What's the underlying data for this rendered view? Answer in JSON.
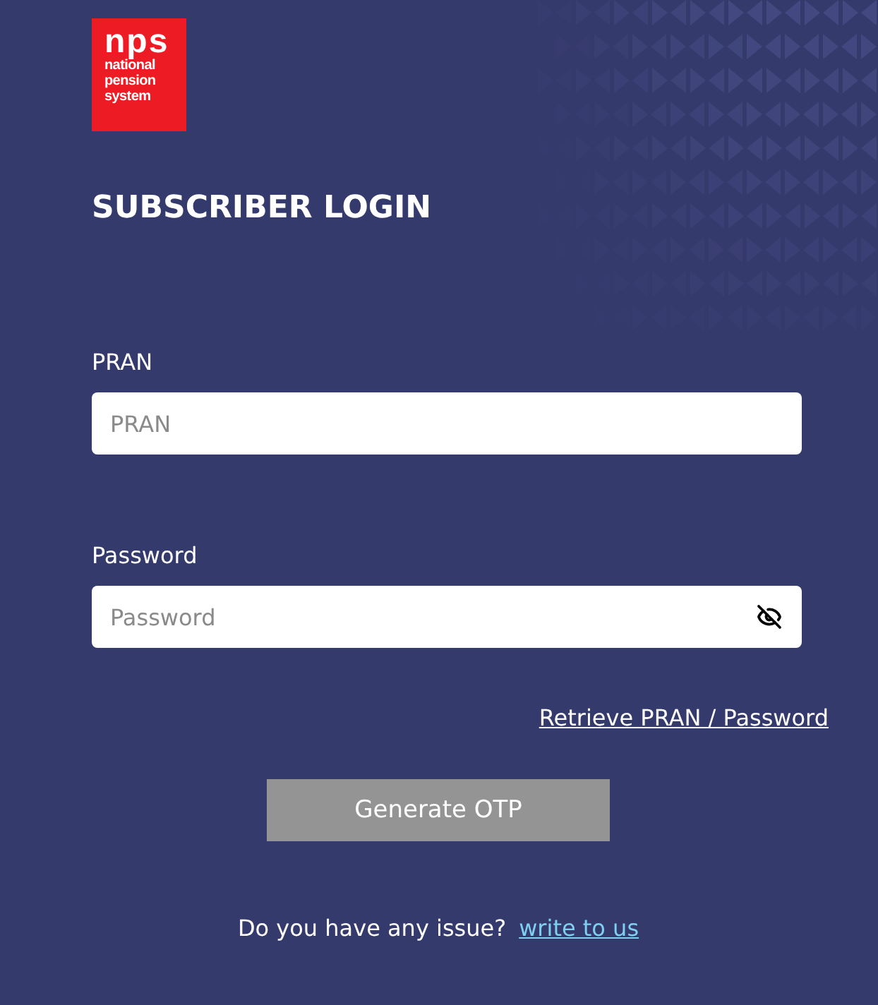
{
  "logo": {
    "mark": "nps",
    "lines": [
      "national",
      "pension",
      "system"
    ]
  },
  "title": "SUBSCRIBER LOGIN",
  "fields": [
    {
      "label": "PRAN",
      "placeholder": "PRAN",
      "kind": "text"
    },
    {
      "label": "Password",
      "placeholder": "Password",
      "kind": "password"
    }
  ],
  "retrieve_link": "Retrieve PRAN / Password",
  "button": {
    "label": "Generate OTP",
    "disabled": true
  },
  "footer": {
    "text": "Do you have any issue?",
    "link": "write to us"
  }
}
